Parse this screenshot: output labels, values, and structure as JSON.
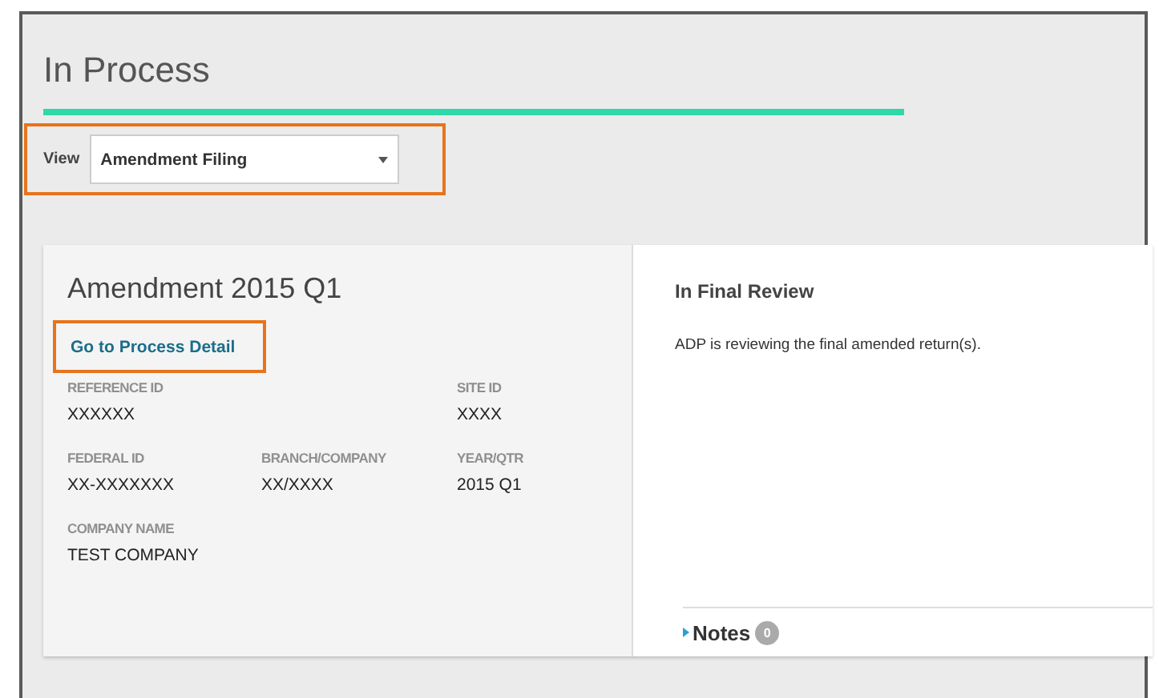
{
  "page": {
    "title": "In Process"
  },
  "view": {
    "label": "View",
    "value": "Amendment Filing"
  },
  "card": {
    "title": "Amendment 2015 Q1",
    "link": "Go to Process Detail",
    "rows": [
      [
        {
          "label": "REFERENCE ID",
          "value": "XXXXXX"
        },
        null,
        {
          "label": "SITE ID",
          "value": "XXXX"
        }
      ],
      [
        {
          "label": "FEDERAL ID",
          "value": "XX-XXXXXXX"
        },
        {
          "label": "BRANCH/COMPANY",
          "value": "XX/XXXX"
        },
        {
          "label": "YEAR/QTR",
          "value": "2015 Q1"
        }
      ],
      [
        {
          "label": "COMPANY NAME",
          "value": "TEST COMPANY"
        },
        null,
        null
      ]
    ],
    "status": {
      "title": "In Final Review",
      "text": "ADP is reviewing the final amended return(s)."
    },
    "notes": {
      "label": "Notes",
      "count": "0",
      "expanded": false
    }
  }
}
